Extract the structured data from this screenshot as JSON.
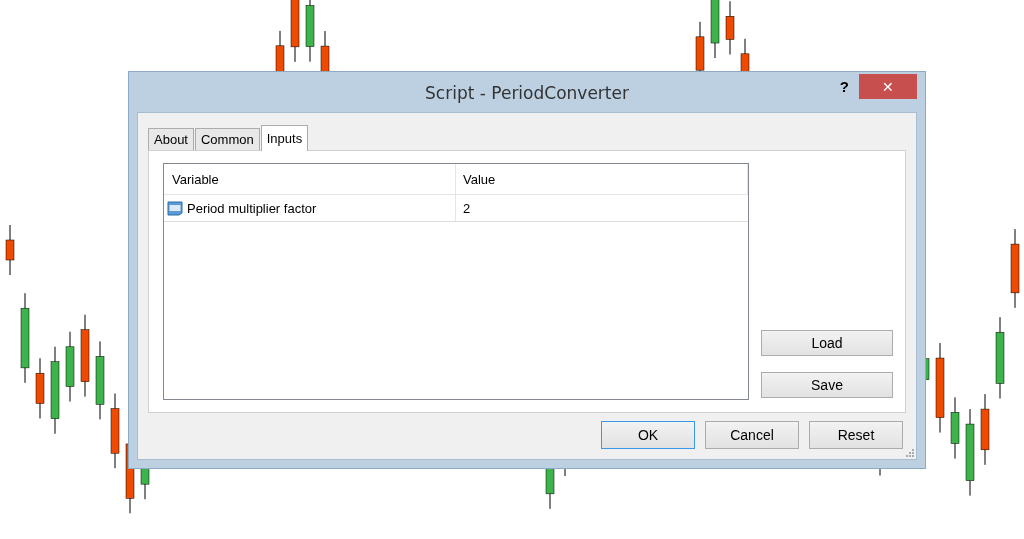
{
  "window": {
    "title": "Script - PeriodConverter",
    "help": "?",
    "close": "✕"
  },
  "tabs": [
    {
      "label": "About",
      "selected": false
    },
    {
      "label": "Common",
      "selected": false
    },
    {
      "label": "Inputs",
      "selected": true
    }
  ],
  "table": {
    "columns": [
      "Variable",
      "Value"
    ],
    "rows": [
      {
        "variable": "Period multiplier factor",
        "value": "2"
      }
    ]
  },
  "side_buttons": [
    "Load",
    "Save"
  ],
  "buttons": [
    {
      "label": "OK",
      "default": true
    },
    {
      "label": "Cancel",
      "default": false
    },
    {
      "label": "Reset",
      "default": false
    }
  ]
}
